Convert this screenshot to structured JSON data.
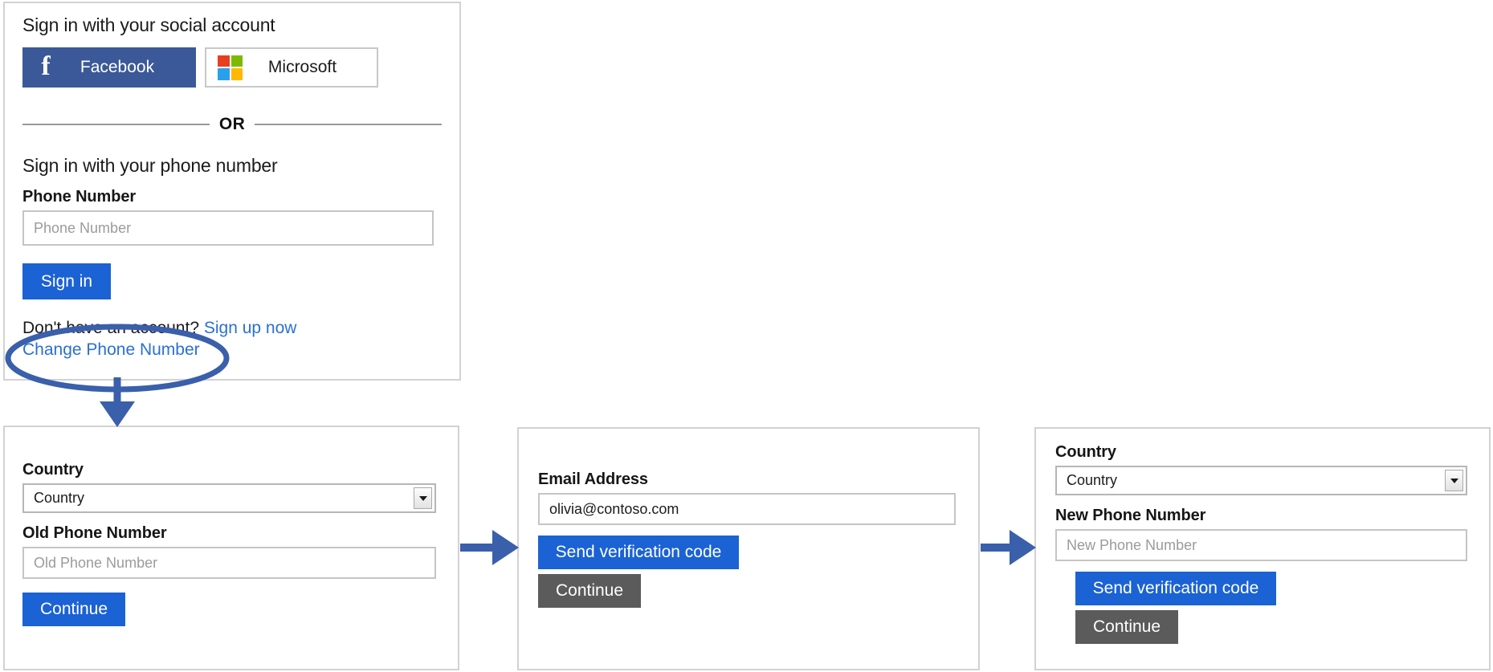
{
  "colors": {
    "facebook_blue": "#3b5998",
    "primary_blue": "#1b62d4",
    "disabled_grey": "#5b5b5b",
    "link_blue": "#2b6fd6",
    "annotation_blue": "#3a5fab",
    "ms_red": "#e8401f",
    "ms_green": "#7cba00",
    "ms_blue": "#2ba0ea",
    "ms_yellow": "#ffb900",
    "panel_border": "#d2d2d2",
    "input_border": "#c5c5c5"
  },
  "signin_panel": {
    "social_heading": "Sign in with your social account",
    "facebook_button": {
      "label": "Facebook",
      "icon": "facebook-f-glyph",
      "glyph": "f"
    },
    "microsoft_button": {
      "label": "Microsoft",
      "icon": "microsoft-logo"
    },
    "divider_label": "OR",
    "phone_heading": "Sign in with your phone number",
    "phone_field": {
      "label": "Phone Number",
      "value": "",
      "placeholder": "Phone Number"
    },
    "signin_button": "Sign in",
    "account_prompt": "Don't have an account?",
    "signup_link": "Sign up now",
    "change_phone_link": "Change Phone Number"
  },
  "old_phone_panel": {
    "country_field": {
      "label": "Country",
      "selected": "Country"
    },
    "old_phone_field": {
      "label": "Old Phone Number",
      "value": "",
      "placeholder": "Old Phone Number"
    },
    "continue_button": "Continue"
  },
  "email_panel": {
    "email_field": {
      "label": "Email Address",
      "value": "olivia@contoso.com",
      "placeholder": "Email Address"
    },
    "send_code_button": "Send verification code",
    "continue_button": "Continue"
  },
  "new_phone_panel": {
    "country_field": {
      "label": "Country",
      "selected": "Country"
    },
    "new_phone_field": {
      "label": "New Phone Number",
      "value": "",
      "placeholder": "New Phone Number"
    },
    "send_code_button": "Send verification code",
    "continue_button": "Continue"
  },
  "annotations": {
    "highlight_ellipse": "ellipse-around-change-phone-number",
    "flow_arrow_down": "arrow-signin-to-old-phone",
    "flow_arrow_right_1": "arrow-old-phone-to-email",
    "flow_arrow_right_2": "arrow-email-to-new-phone"
  }
}
